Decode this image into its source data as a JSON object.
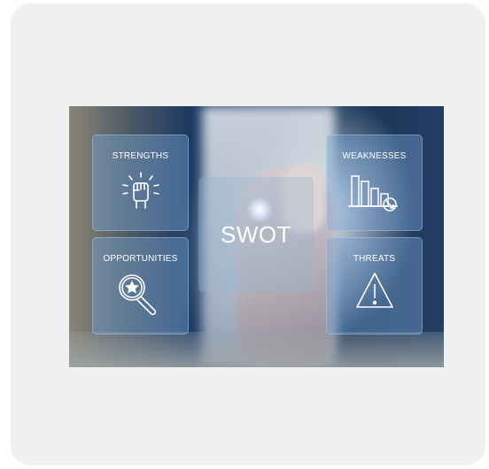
{
  "center_label": "SWOT",
  "panels": {
    "strengths": {
      "title": "STRENGTHS",
      "icon": "raised-fist-icon"
    },
    "weaknesses": {
      "title": "WEAKNESSES",
      "icon": "declining-bars-icon"
    },
    "opportunities": {
      "title": "OPPORTUNITIES",
      "icon": "magnifier-star-icon"
    },
    "threats": {
      "title": "THREATS",
      "icon": "warning-triangle-icon"
    }
  }
}
